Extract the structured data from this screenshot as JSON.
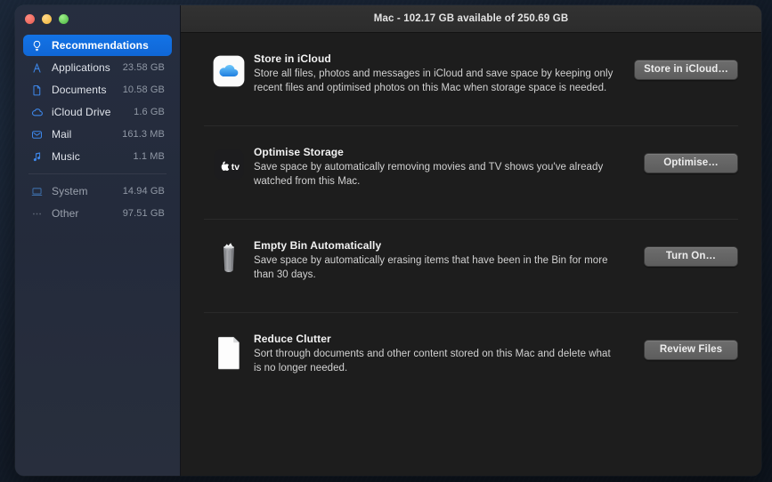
{
  "window": {
    "title": "Mac - 102.17 GB available of 250.69 GB",
    "traffic_lights": [
      {
        "name": "close",
        "color": "#ed6a5f"
      },
      {
        "name": "minimize",
        "color": "#f5bf4f"
      },
      {
        "name": "zoom",
        "color": "#61c555"
      }
    ]
  },
  "sidebar": {
    "items": [
      {
        "label": "Recommendations",
        "size": "",
        "icon": "lightbulb-icon",
        "selected": true,
        "dim": false
      },
      {
        "label": "Applications",
        "size": "23.58 GB",
        "icon": "applications-icon",
        "selected": false,
        "dim": false
      },
      {
        "label": "Documents",
        "size": "10.58 GB",
        "icon": "documents-icon",
        "selected": false,
        "dim": false
      },
      {
        "label": "iCloud Drive",
        "size": "1.6 GB",
        "icon": "cloud-icon",
        "selected": false,
        "dim": false
      },
      {
        "label": "Mail",
        "size": "161.3 MB",
        "icon": "mail-icon",
        "selected": false,
        "dim": false
      },
      {
        "label": "Music",
        "size": "1.1 MB",
        "icon": "music-note-icon",
        "selected": false,
        "dim": false
      },
      {
        "label": "System",
        "size": "14.94 GB",
        "icon": "system-laptop-icon",
        "selected": false,
        "dim": true
      },
      {
        "label": "Other",
        "size": "97.51 GB",
        "icon": "ellipsis-icon",
        "selected": false,
        "dim": true
      }
    ],
    "separator_after_index": 5,
    "selection_color": "#1373e6"
  },
  "recommendations": [
    {
      "title": "Store in iCloud",
      "description": "Store all files, photos and messages in iCloud and save space by keeping only recent files and optimised photos on this Mac when storage space is needed.",
      "button": "Store in iCloud…",
      "icon": "icloud-app-icon"
    },
    {
      "title": "Optimise Storage",
      "description": "Save space by automatically removing movies and TV shows you've already watched from this Mac.",
      "button": "Optimise…",
      "icon": "apple-tv-app-icon"
    },
    {
      "title": "Empty Bin Automatically",
      "description": "Save space by automatically erasing items that have been in the Bin for more than 30 days.",
      "button": "Turn On…",
      "icon": "trash-bin-icon"
    },
    {
      "title": "Reduce Clutter",
      "description": "Sort through documents and other content stored on this Mac and delete what is no longer needed.",
      "button": "Review Files",
      "icon": "document-page-icon"
    }
  ]
}
